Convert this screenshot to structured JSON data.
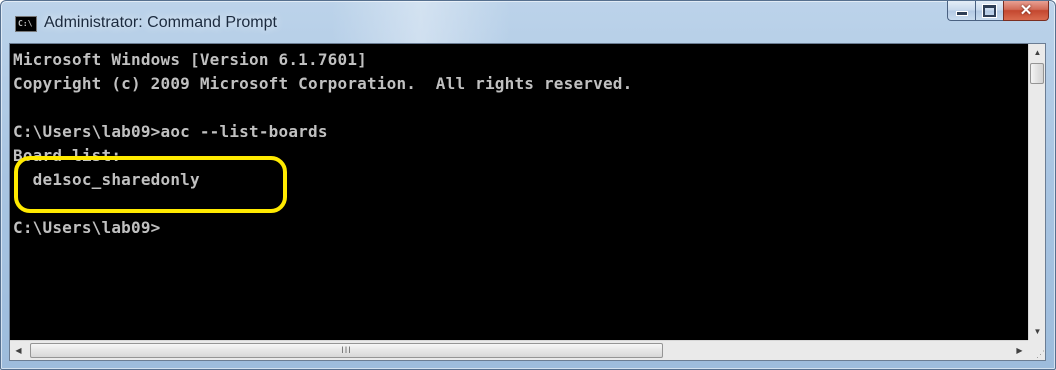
{
  "window": {
    "title": "Administrator: Command Prompt",
    "icon": "cmd-icon",
    "icon_text": "C:\\"
  },
  "caption_buttons": {
    "minimize_icon": "minimize-icon",
    "maximize_icon": "maximize-icon",
    "close_icon": "close-icon",
    "close_glyph": "✕"
  },
  "console": {
    "lines": [
      "Microsoft Windows [Version 6.1.7601]",
      "Copyright (c) 2009 Microsoft Corporation.  All rights reserved.",
      "",
      "C:\\Users\\lab09>aoc --list-boards",
      "Board list:",
      "  de1soc_sharedonly",
      "",
      "C:\\Users\\lab09>"
    ],
    "text_color": "#c0c0c0",
    "background_color": "#000000",
    "highlight_color": "#ffea00"
  },
  "scrollbars": {
    "up_arrow": "▲",
    "down_arrow": "▼",
    "left_arrow": "◀",
    "right_arrow": "▶",
    "grip": "III",
    "size_grip": "⋰"
  }
}
